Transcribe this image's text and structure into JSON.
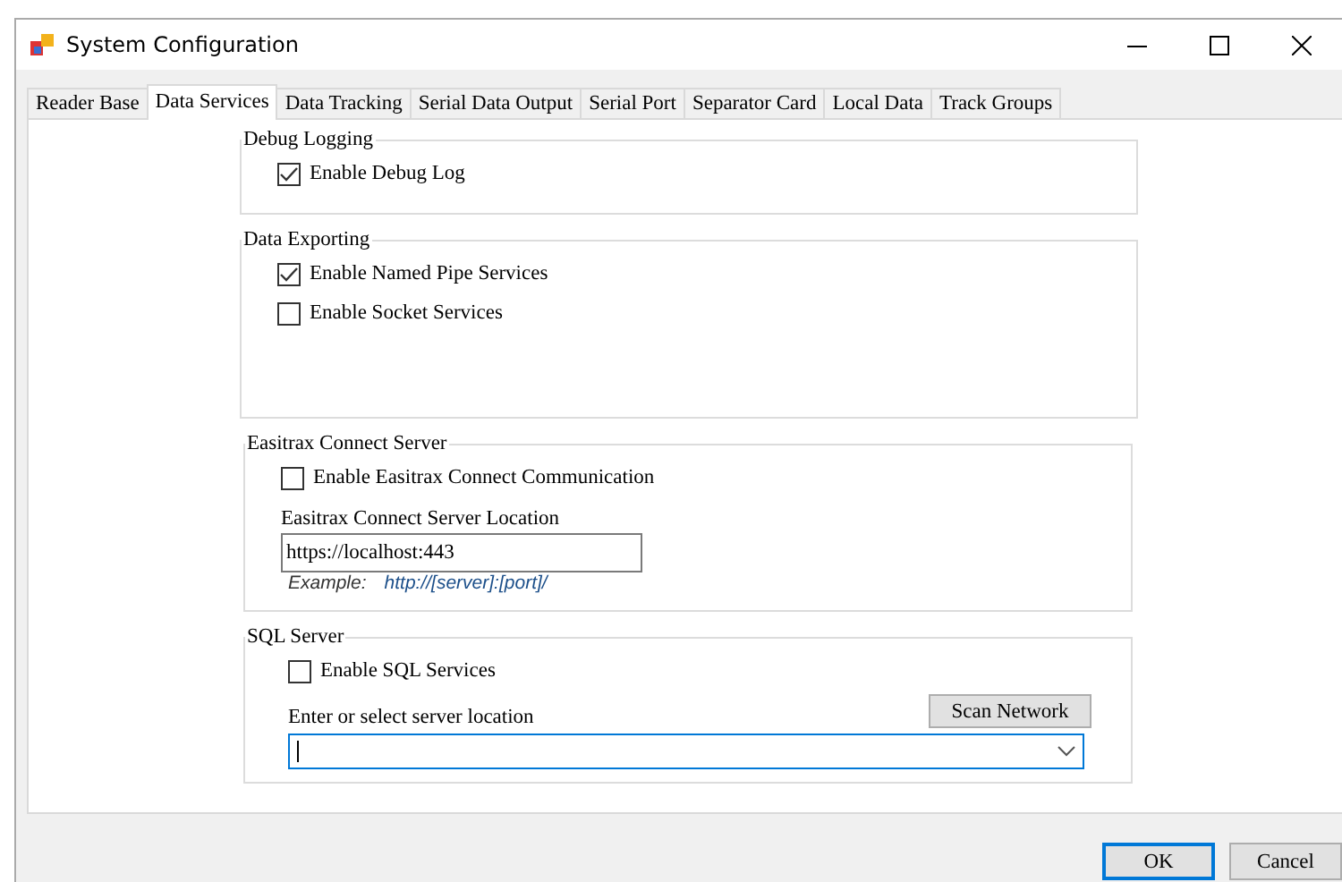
{
  "window": {
    "title": "System Configuration"
  },
  "tabs": [
    {
      "label": "Reader Base",
      "selected": false
    },
    {
      "label": "Data Services",
      "selected": true
    },
    {
      "label": "Data Tracking",
      "selected": false
    },
    {
      "label": "Serial Data Output",
      "selected": false
    },
    {
      "label": "Serial Port",
      "selected": false
    },
    {
      "label": "Separator Card",
      "selected": false
    },
    {
      "label": "Local Data",
      "selected": false
    },
    {
      "label": "Track Groups",
      "selected": false
    }
  ],
  "debug_logging": {
    "title": "Debug Logging",
    "options": [
      {
        "label": "Enable Debug Log",
        "checked": true
      }
    ]
  },
  "data_exporting": {
    "title": "Data Exporting",
    "options": [
      {
        "label": "Enable Named Pipe Services",
        "checked": true
      },
      {
        "label": "Enable Socket Services",
        "checked": false
      }
    ]
  },
  "easitrax_connect": {
    "title": "Easitrax Connect Server",
    "option": {
      "label": "Enable Easitrax Connect Communication",
      "checked": false
    },
    "location_label": "Easitrax Connect Server Location",
    "location_value": "https://localhost:443",
    "example_label": "Example:",
    "example_value": "http://[server]:[port]/"
  },
  "sql_server": {
    "title": "SQL Server",
    "option": {
      "label": "Enable SQL Services",
      "checked": false
    },
    "scan_button": "Scan Network",
    "location_label": "Enter or select server location"
  },
  "buttons": [
    {
      "label": "OK",
      "default": true
    },
    {
      "label": "Cancel",
      "default": false
    }
  ]
}
